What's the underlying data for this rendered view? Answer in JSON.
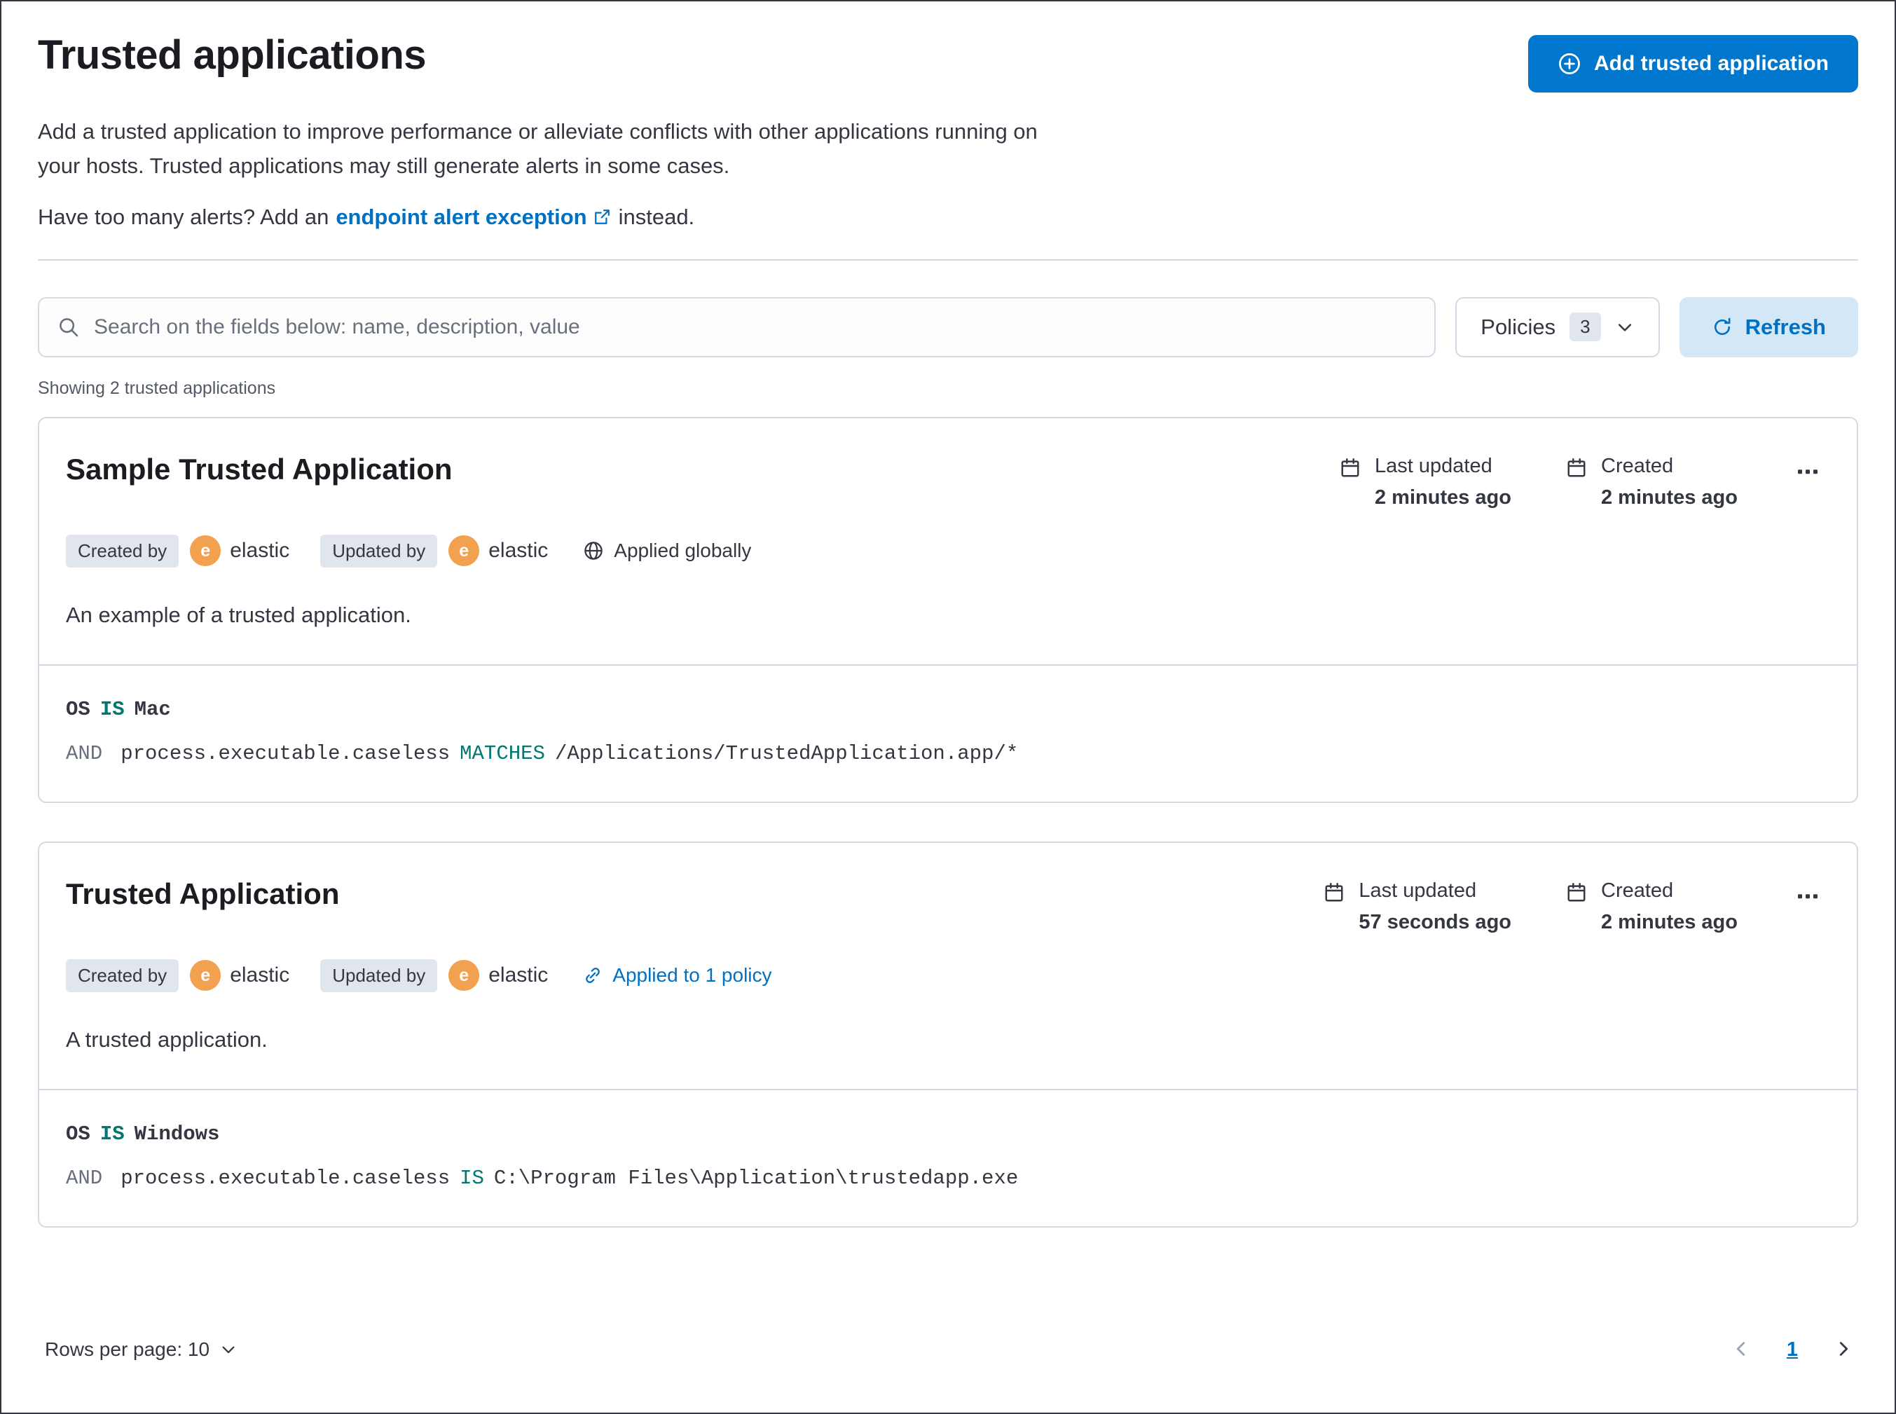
{
  "header": {
    "title": "Trusted applications",
    "add_button_label": "Add trusted application",
    "description_line1": "Add a trusted application to improve performance or alleviate conflicts with other applications running on",
    "description_line2": "your hosts. Trusted applications may still generate alerts in some cases.",
    "alerts_text_before": "Have too many alerts? Add an",
    "alerts_link_label": "endpoint alert exception",
    "alerts_text_after": "instead."
  },
  "toolbar": {
    "search_placeholder": "Search on the fields below: name, description, value",
    "policies_label": "Policies",
    "policies_count": "3",
    "refresh_label": "Refresh"
  },
  "results_summary": "Showing 2 trusted applications",
  "accent_colors": {
    "primary_button": "#0077CC",
    "link": "#0071c2",
    "avatar": "#F1A14F",
    "code_keyword": "#007871"
  },
  "cards": [
    {
      "title": "Sample Trusted Application",
      "created_by_badge": "Created by",
      "created_by_avatar": "e",
      "created_by_user": "elastic",
      "updated_by_badge": "Updated by",
      "updated_by_avatar": "e",
      "updated_by_user": "elastic",
      "scope_label": "Applied globally",
      "last_updated_label": "Last updated",
      "last_updated_value": "2 minutes ago",
      "created_label": "Created",
      "created_value": "2 minutes ago",
      "description": "An example of a trusted application.",
      "criteria": {
        "os_field": "OS",
        "os_operator": "IS",
        "os_value": "Mac",
        "entry_conjunction": "AND",
        "entry_field": "process.executable.caseless",
        "entry_operator": "MATCHES",
        "entry_value": "/Applications/TrustedApplication.app/*"
      }
    },
    {
      "title": "Trusted Application",
      "created_by_badge": "Created by",
      "created_by_avatar": "e",
      "created_by_user": "elastic",
      "updated_by_badge": "Updated by",
      "updated_by_avatar": "e",
      "updated_by_user": "elastic",
      "scope_label": "Applied to 1 policy",
      "last_updated_label": "Last updated",
      "last_updated_value": "57 seconds ago",
      "created_label": "Created",
      "created_value": "2 minutes ago",
      "description": "A trusted application.",
      "criteria": {
        "os_field": "OS",
        "os_operator": "IS",
        "os_value": "Windows",
        "entry_conjunction": "AND",
        "entry_field": "process.executable.caseless",
        "entry_operator": "IS",
        "entry_value": "C:\\Program Files\\Application\\trustedapp.exe"
      }
    }
  ],
  "footer": {
    "rows_per_page_label": "Rows per page: 10",
    "page_number": "1"
  }
}
